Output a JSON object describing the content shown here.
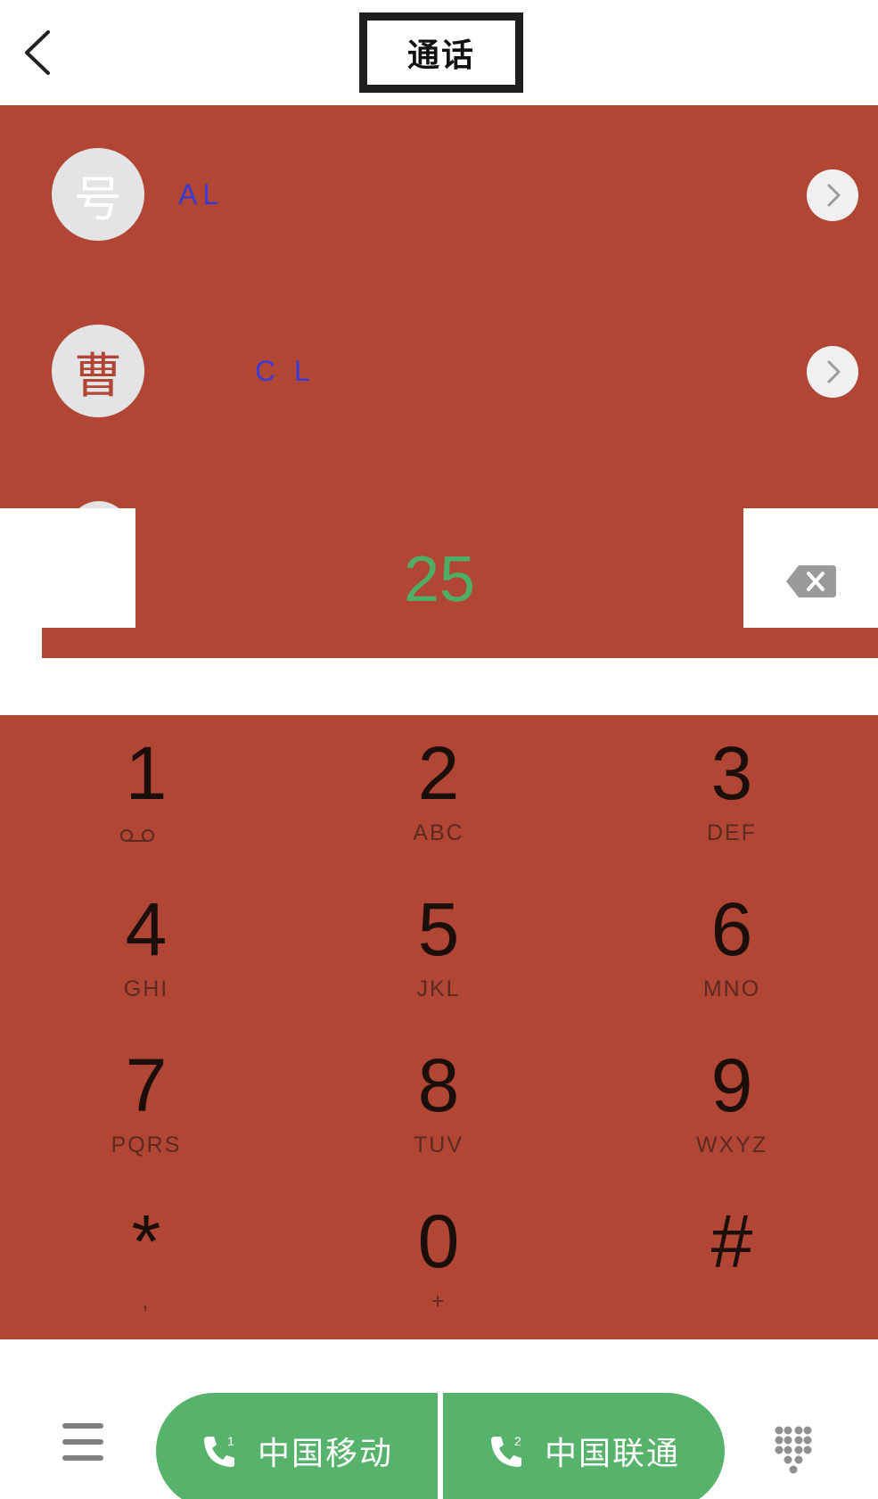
{
  "header": {
    "title": "通话",
    "back_icon": "chevron-left-icon"
  },
  "contacts": [
    {
      "avatar_char": "号",
      "name": "AL"
    },
    {
      "avatar_char": "曹",
      "name": "C L"
    }
  ],
  "dial": {
    "number": "25",
    "delete_icon": "backspace-icon"
  },
  "keypad": {
    "keys": [
      {
        "digit": "1",
        "letters": ""
      },
      {
        "digit": "2",
        "letters": "ABC"
      },
      {
        "digit": "3",
        "letters": "DEF"
      },
      {
        "digit": "4",
        "letters": "GHI"
      },
      {
        "digit": "5",
        "letters": "JKL"
      },
      {
        "digit": "6",
        "letters": "MNO"
      },
      {
        "digit": "7",
        "letters": "PQRS"
      },
      {
        "digit": "8",
        "letters": "TUV"
      },
      {
        "digit": "9",
        "letters": "WXYZ"
      },
      {
        "digit": "*",
        "letters": ","
      },
      {
        "digit": "0",
        "letters": "+"
      },
      {
        "digit": "#",
        "letters": ""
      }
    ]
  },
  "bottom_bar": {
    "sim1_label": "中国移动",
    "sim2_label": "中国联通",
    "sim1_number": "1",
    "sim2_number": "2",
    "menu_icon": "menu-icon",
    "keypad_icon": "dialpad-grid-icon"
  },
  "colors": {
    "panel_red": "#b24635",
    "call_green": "#57b36b",
    "number_green": "#4fae66",
    "name_blue": "#3a3ad6"
  }
}
